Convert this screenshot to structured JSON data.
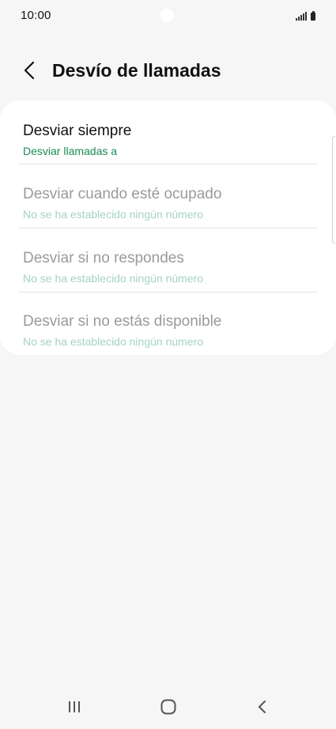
{
  "status_bar": {
    "time": "10:00",
    "icons": [
      "signal-icon",
      "battery-icon"
    ]
  },
  "header": {
    "back_icon": "chevron-left-icon",
    "title": "Desvío de llamadas"
  },
  "call_forwarding": {
    "items": [
      {
        "title": "Desviar siempre",
        "subtitle": "Desviar llamadas a",
        "enabled": true
      },
      {
        "title": "Desviar cuando esté ocupado",
        "subtitle": "No se ha establecido ningún número",
        "enabled": false
      },
      {
        "title": "Desviar si no respondes",
        "subtitle": "No se ha establecido ningún número",
        "enabled": false
      },
      {
        "title": "Desviar si no estás disponible",
        "subtitle": "No se ha establecido ningún número",
        "enabled": false
      }
    ]
  },
  "colors": {
    "accent": "#1a8a55",
    "background": "#f6f6f6",
    "card": "#ffffff",
    "disabled_text": "#9a9a9a"
  },
  "nav_bar": {
    "icons": [
      "recent-apps-icon",
      "home-icon",
      "back-icon"
    ]
  }
}
